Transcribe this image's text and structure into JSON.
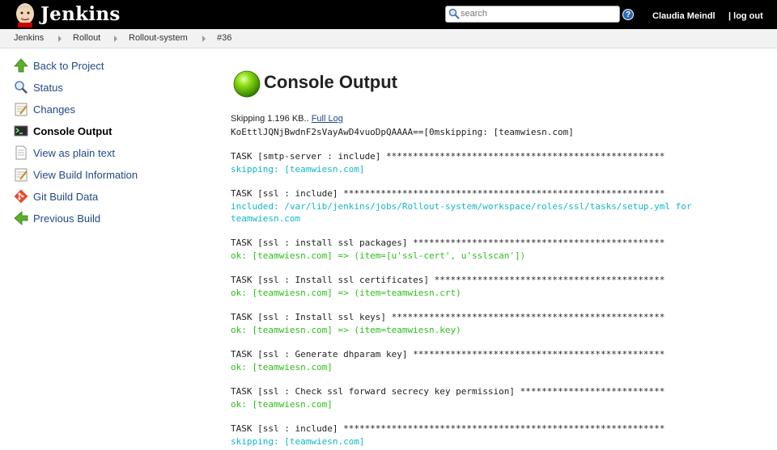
{
  "header": {
    "brand": "Jenkins",
    "search_placeholder": "search",
    "help": "?",
    "user": "Claudia Meindl",
    "logout": "| log out"
  },
  "breadcrumb": [
    "Jenkins",
    "Rollout",
    "Rollout-system",
    "#36"
  ],
  "sidebar": [
    {
      "label": "Back to Project",
      "icon": "up-arrow-icon"
    },
    {
      "label": "Status",
      "icon": "magnifier-icon"
    },
    {
      "label": "Changes",
      "icon": "notepad-icon"
    },
    {
      "label": "Console Output",
      "icon": "terminal-icon"
    },
    {
      "label": "View as plain text",
      "icon": "document-icon"
    },
    {
      "label": "View Build Information",
      "icon": "notepad-icon"
    },
    {
      "label": "Git Build Data",
      "icon": "git-icon"
    },
    {
      "label": "Previous Build",
      "icon": "left-arrow-icon"
    }
  ],
  "main": {
    "title": "Console Output",
    "status_color": "#6ad000",
    "skipping_text": "Skipping 1.196 KB.. ",
    "full_log_link": "Full Log"
  },
  "console_lines": [
    {
      "text": "KoEttlJQNjBwdnF2sVayAwD4vuoDpQAAAA==[0mskipping: [teamwiesn.com]",
      "style": "plain"
    },
    {
      "text": "TASK [smtp-server : include] ****************************************************",
      "style": "task"
    },
    {
      "text": "skipping: [teamwiesn.com]",
      "style": "cyan"
    },
    {
      "text": "TASK [ssl : include] ************************************************************",
      "style": "task"
    },
    {
      "text": "included: /var/lib/jenkins/jobs/Rollout-system/workspace/roles/ssl/tasks/setup.yml for",
      "style": "cyan"
    },
    {
      "text": "teamwiesn.com",
      "style": "cyan"
    },
    {
      "text": "TASK [ssl : install ssl packages] ***********************************************",
      "style": "task"
    },
    {
      "text": "ok: [teamwiesn.com] => (item=[u'ssl-cert', u'sslscan'])",
      "style": "green"
    },
    {
      "text": "TASK [ssl : Install ssl certificates] *******************************************",
      "style": "task"
    },
    {
      "text": "ok: [teamwiesn.com] => (item=teamwiesn.crt)",
      "style": "green"
    },
    {
      "text": "TASK [ssl : Install ssl keys] ***************************************************",
      "style": "task"
    },
    {
      "text": "ok: [teamwiesn.com] => (item=teamwiesn.key)",
      "style": "green"
    },
    {
      "text": "TASK [ssl : Generate dhparam key] ***********************************************",
      "style": "task"
    },
    {
      "text": "ok: [teamwiesn.com]",
      "style": "green"
    },
    {
      "text": "TASK [ssl : Check ssl forward secrecy key permission] ***************************",
      "style": "task"
    },
    {
      "text": "ok: [teamwiesn.com]",
      "style": "green"
    },
    {
      "text": "TASK [ssl : include] ************************************************************",
      "style": "task"
    },
    {
      "text": "skipping: [teamwiesn.com]",
      "style": "cyan"
    }
  ]
}
